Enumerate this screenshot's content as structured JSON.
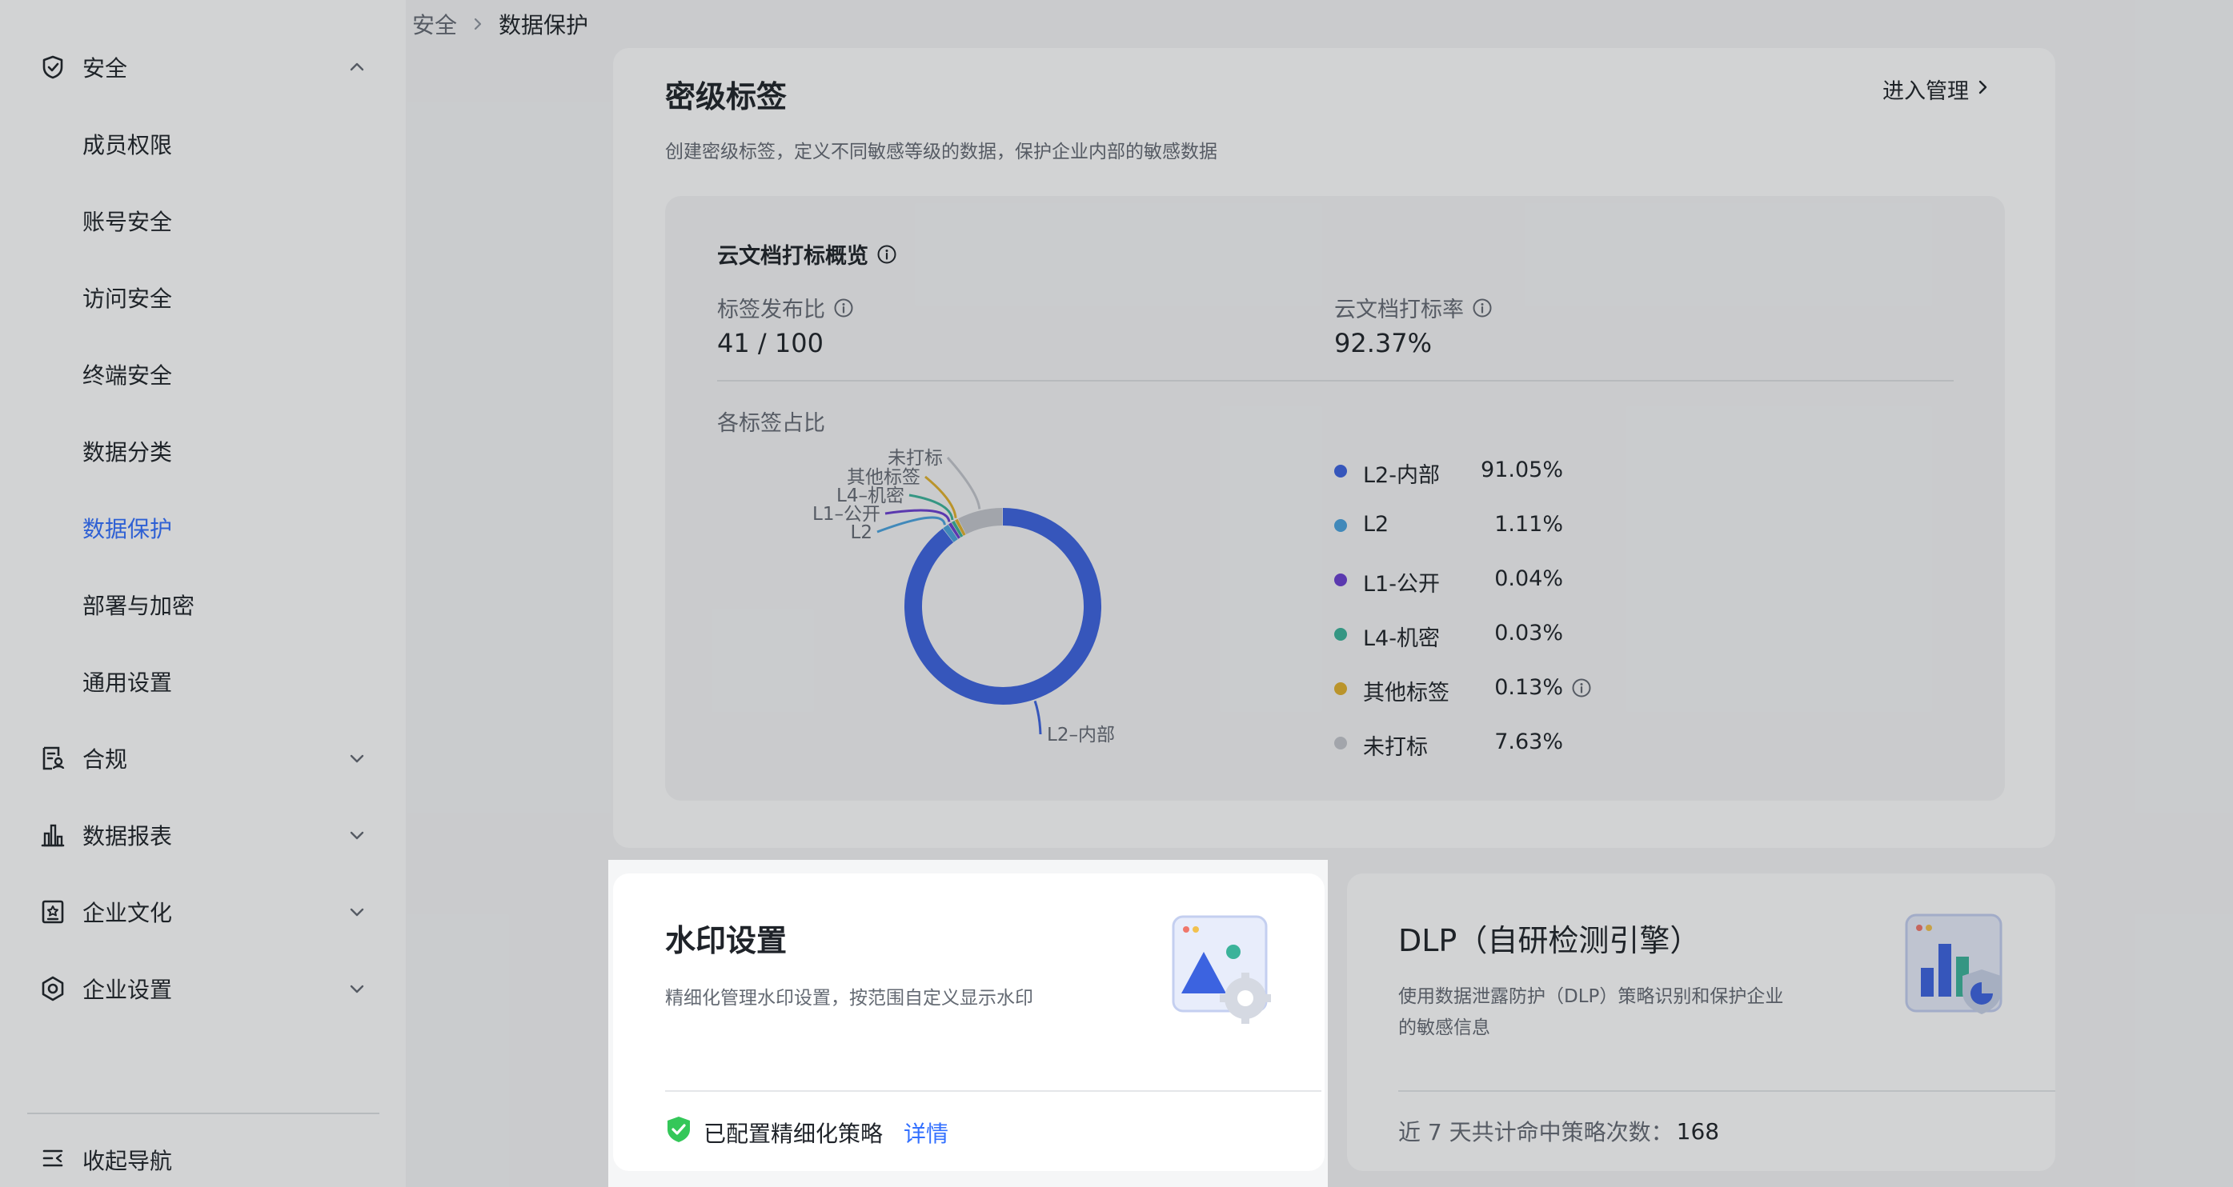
{
  "breadcrumb": {
    "parent": "安全",
    "current": "数据保护"
  },
  "sidebar": {
    "groups": [
      {
        "label": "安全",
        "icon": "shield-icon",
        "expanded": true
      },
      {
        "label": "合规",
        "icon": "compliance-icon",
        "expanded": false
      },
      {
        "label": "数据报表",
        "icon": "bar-chart-icon",
        "expanded": false
      },
      {
        "label": "企业文化",
        "icon": "culture-icon",
        "expanded": false
      },
      {
        "label": "企业设置",
        "icon": "settings-icon",
        "expanded": false
      }
    ],
    "items": [
      {
        "label": "成员权限"
      },
      {
        "label": "账号安全"
      },
      {
        "label": "访问安全"
      },
      {
        "label": "终端安全"
      },
      {
        "label": "数据分类"
      },
      {
        "label": "数据保护",
        "active": true
      },
      {
        "label": "部署与加密"
      },
      {
        "label": "通用设置"
      }
    ],
    "collapse_label": "收起导航"
  },
  "classification": {
    "title": "密级标签",
    "description": "创建密级标签，定义不同敏感等级的数据，保护企业内部的敏感数据",
    "manage_label": "进入管理",
    "overview_title": "云文档打标概览",
    "publish_ratio_label": "标签发布比",
    "publish_ratio_value": "41 / 100",
    "tag_rate_label": "云文档打标率",
    "tag_rate_value": "92.37%",
    "distribution_label": "各标签占比"
  },
  "chart_data": {
    "type": "pie",
    "title": "",
    "categories": [
      "L2-内部",
      "L2",
      "L1-公开",
      "L4-机密",
      "其他标签",
      "未打标"
    ],
    "values": [
      91.05,
      1.11,
      0.04,
      0.03,
      0.13,
      7.63
    ],
    "value_labels": [
      "91.05%",
      "1.11%",
      "0.04%",
      "0.03%",
      "0.13%",
      "7.63%"
    ],
    "callout_labels": [
      "L2–内部",
      "L2",
      "L1–公开",
      "L4–机密",
      "其他标签",
      "未打标"
    ],
    "colors": [
      "#3c63e0",
      "#4aa3df",
      "#6b3fd1",
      "#3bb39a",
      "#e1b12c",
      "#c3c6cc"
    ],
    "legend": "right",
    "donut": true
  },
  "watermark": {
    "title": "水印设置",
    "description": "精细化管理水印设置，按范围自定义显示水印",
    "status": "已配置精细化策略",
    "detail_link": "详情"
  },
  "dlp": {
    "title": "DLP（自研检测引擎）",
    "description_line1": "使用数据泄露防护（DLP）策略识别和保护企业",
    "description_line2": "的敏感信息",
    "stat_label": "近 7 天共计命中策略次数：",
    "stat_value": "168"
  }
}
